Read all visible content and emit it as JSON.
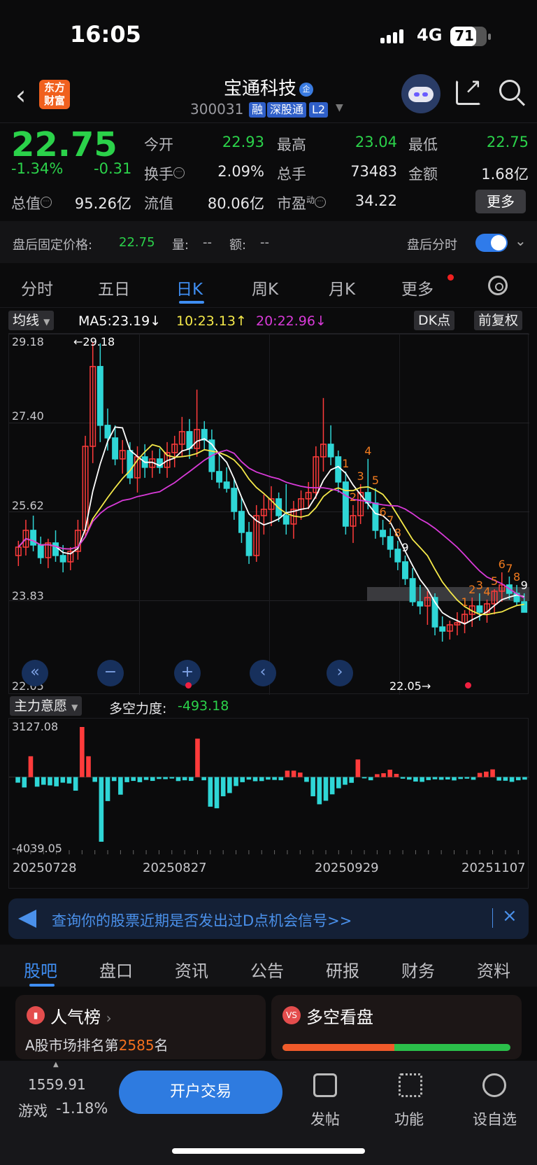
{
  "status_bar": {
    "time": "16:05",
    "network": "4G",
    "battery": "71"
  },
  "header": {
    "logo": "东方财富",
    "stock_name": "宝通科技",
    "name_badge": "企",
    "stock_code": "300031",
    "tags": [
      "融",
      "深股通",
      "L2"
    ]
  },
  "quote": {
    "price": "22.75",
    "change_pct": "-1.34%",
    "change": "-0.31",
    "rows": [
      {
        "l1": "今开",
        "v1": "22.93",
        "l2": "最高",
        "v2": "23.04",
        "l3": "最低",
        "v3": "22.75"
      },
      {
        "l1": "换手",
        "v1": "2.09%",
        "l2": "总手",
        "v2": "73483",
        "l3": "金额",
        "v3": "1.68亿"
      },
      {
        "l0": "总值",
        "v0": "95.26亿",
        "l1": "流值",
        "v1": "80.06亿",
        "l2": "市盈",
        "l2sup": "动",
        "v2": "34.22"
      }
    ],
    "more_button": "更多"
  },
  "after_hours": {
    "label": "盘后固定价格:",
    "price": "22.75",
    "vol_label": "量:",
    "vol": "--",
    "amt_label": "额:",
    "amt": "--",
    "toggle_label": "盘后分时",
    "toggle_on": true
  },
  "period_tabs": [
    "分时",
    "五日",
    "日K",
    "周K",
    "月K",
    "更多"
  ],
  "active_period": "日K",
  "kline_bar": {
    "indicator": "均线",
    "ma5": "MA5:23.19",
    "ma10": "10:23.13",
    "ma20": "20:22.96",
    "dk_button": "DK点",
    "adjust_button": "前复权"
  },
  "colors": {
    "up": "#ff3b3b",
    "down": "#2fd6d6",
    "ma5": "#ffffff",
    "ma10": "#f5e94a",
    "ma20": "#d83ad8",
    "accent": "#3f8ef2",
    "green_text": "#2bd24a"
  },
  "chart_data": [
    {
      "type": "candlestick",
      "title": "日K",
      "y_axis_labels": [
        "29.18",
        "27.40",
        "25.62",
        "23.83",
        "22.05"
      ],
      "ylim": [
        22.05,
        29.18
      ],
      "max_label": "29.18",
      "min_label": "22.05",
      "series": [
        {
          "name": "MA5",
          "last": "23.19"
        },
        {
          "name": "10",
          "last": "23.13"
        },
        {
          "name": "20",
          "last": "22.96"
        }
      ],
      "candles": [
        [
          24.1,
          24.45,
          23.85,
          24.3
        ],
        [
          24.3,
          24.95,
          24.1,
          24.7
        ],
        [
          24.7,
          25.05,
          24.2,
          24.35
        ],
        [
          24.35,
          24.55,
          23.9,
          24.05
        ],
        [
          24.05,
          24.5,
          23.8,
          24.4
        ],
        [
          24.4,
          24.7,
          23.95,
          24.1
        ],
        [
          24.1,
          24.35,
          23.7,
          23.95
        ],
        [
          23.95,
          24.3,
          23.75,
          24.2
        ],
        [
          24.2,
          24.95,
          24.0,
          24.7
        ],
        [
          24.7,
          26.95,
          24.55,
          26.7
        ],
        [
          26.7,
          29.18,
          26.3,
          28.6
        ],
        [
          28.6,
          29.15,
          26.8,
          27.2
        ],
        [
          27.2,
          27.6,
          26.6,
          26.9
        ],
        [
          26.9,
          27.2,
          26.25,
          26.4
        ],
        [
          26.4,
          26.85,
          26.05,
          26.6
        ],
        [
          26.6,
          26.8,
          25.8,
          25.95
        ],
        [
          25.95,
          26.7,
          25.6,
          26.45
        ],
        [
          26.45,
          26.75,
          25.95,
          26.2
        ],
        [
          26.2,
          26.6,
          25.95,
          26.4
        ],
        [
          26.4,
          26.65,
          26.05,
          26.2
        ],
        [
          26.2,
          26.8,
          25.95,
          26.55
        ],
        [
          26.55,
          26.95,
          26.2,
          26.75
        ],
        [
          26.75,
          27.4,
          26.45,
          27.05
        ],
        [
          27.05,
          27.35,
          26.4,
          26.65
        ],
        [
          26.65,
          28.05,
          26.45,
          27.1
        ],
        [
          27.1,
          27.3,
          26.6,
          26.85
        ],
        [
          26.85,
          27.1,
          25.9,
          26.1
        ],
        [
          26.1,
          26.5,
          25.7,
          25.85
        ],
        [
          25.85,
          26.2,
          25.6,
          25.7
        ],
        [
          25.7,
          25.95,
          24.95,
          25.15
        ],
        [
          25.15,
          25.5,
          24.4,
          24.65
        ],
        [
          24.65,
          24.9,
          23.9,
          24.1
        ],
        [
          24.1,
          25.3,
          23.95,
          25.05
        ],
        [
          25.05,
          25.55,
          24.6,
          25.2
        ],
        [
          25.2,
          25.75,
          24.8,
          25.45
        ],
        [
          25.45,
          25.6,
          24.9,
          25.05
        ],
        [
          25.05,
          25.8,
          24.6,
          24.85
        ],
        [
          24.85,
          25.4,
          24.5,
          25.2
        ],
        [
          25.2,
          25.65,
          24.95,
          25.45
        ],
        [
          25.45,
          25.85,
          25.2,
          25.6
        ],
        [
          25.6,
          26.7,
          25.45,
          26.45
        ],
        [
          26.45,
          27.85,
          26.1,
          26.75
        ],
        [
          26.75,
          27.2,
          26.25,
          26.45
        ],
        [
          26.45,
          26.6,
          25.6,
          25.85
        ],
        [
          25.85,
          26.1,
          24.6,
          24.8
        ],
        [
          24.8,
          25.3,
          24.4,
          25.05
        ],
        [
          25.05,
          25.8,
          24.85,
          25.6
        ],
        [
          25.6,
          26.4,
          25.2,
          25.35
        ],
        [
          25.35,
          25.7,
          24.5,
          24.7
        ],
        [
          24.7,
          24.95,
          24.35,
          24.55
        ],
        [
          24.55,
          24.75,
          24.05,
          24.25
        ],
        [
          24.25,
          24.45,
          23.75,
          23.95
        ],
        [
          23.95,
          24.1,
          23.4,
          23.55
        ],
        [
          23.55,
          23.8,
          22.9,
          23.0
        ],
        [
          23.0,
          23.4,
          22.7,
          22.9
        ],
        [
          22.9,
          23.25,
          22.45,
          23.1
        ],
        [
          23.1,
          23.2,
          22.2,
          22.4
        ],
        [
          22.4,
          22.65,
          22.05,
          22.3
        ],
        [
          22.3,
          22.55,
          22.1,
          22.45
        ],
        [
          22.45,
          22.75,
          22.2,
          22.5
        ],
        [
          22.5,
          22.8,
          22.25,
          22.7
        ],
        [
          22.7,
          23.1,
          22.4,
          22.9
        ],
        [
          22.9,
          23.2,
          22.55,
          22.75
        ],
        [
          22.75,
          23.05,
          22.5,
          22.95
        ],
        [
          22.95,
          23.3,
          22.7,
          23.25
        ],
        [
          23.25,
          23.7,
          23.0,
          23.4
        ],
        [
          23.4,
          23.6,
          23.05,
          23.2
        ],
        [
          23.2,
          23.4,
          22.9,
          23.0
        ],
        [
          23.0,
          23.2,
          22.75,
          22.75
        ]
      ],
      "td_counts": [
        "1",
        "2",
        "3",
        "4",
        "5",
        "6",
        "7",
        "8",
        "9",
        "1",
        "2",
        "3",
        "4",
        "5",
        "6",
        "7",
        "8",
        "9"
      ]
    },
    {
      "type": "bar",
      "title": "主力意愿",
      "indicator_label": "多空力度:",
      "indicator_value": "-493.18",
      "ylim": [
        -4039.05,
        3127.08
      ],
      "y_axis_labels": [
        "3127.08",
        "-4039.05"
      ],
      "x_labels": [
        "20250728",
        "20250827",
        "20250929",
        "20251107"
      ],
      "values": [
        -350,
        -650,
        1300,
        -600,
        -480,
        -520,
        -580,
        -350,
        -400,
        -850,
        3127,
        1300,
        -300,
        -4039,
        -1500,
        -250,
        -1100,
        -320,
        -240,
        -320,
        -180,
        -240,
        -120,
        -130,
        -90,
        -250,
        -200,
        -240,
        2400,
        -200,
        -1850,
        -1950,
        -1200,
        -1000,
        -560,
        -320,
        -160,
        -260,
        -250,
        -160,
        -180,
        -200,
        400,
        400,
        280,
        -300,
        -1200,
        -1700,
        -1480,
        -1080,
        -700,
        -480,
        -360,
        1100,
        -80,
        -200,
        180,
        240,
        460,
        200,
        -100,
        -160,
        -280,
        -300,
        -190,
        -140,
        -170,
        -150,
        -210,
        -120,
        -100,
        -170,
        260,
        340,
        480,
        -220,
        -230,
        -300,
        -200,
        -160
      ]
    }
  ],
  "controls": [
    "«",
    "−",
    "+",
    "‹",
    "›"
  ],
  "lower_indicator": {
    "name": "主力意愿",
    "label": "多空力度:",
    "value": "-493.18"
  },
  "banner": {
    "text": "查询你的股票近期是否发出过D点机会信号>>",
    "close": "×"
  },
  "bottom_tabs": [
    "股吧",
    "盘口",
    "资讯",
    "公告",
    "研报",
    "财务",
    "资料"
  ],
  "active_bottom_tab": "股吧",
  "cards": {
    "rank": {
      "title": "人气榜",
      "text_prefix": "A股市场排名第",
      "rank": "2585",
      "text_suffix": "名"
    },
    "bullbear": {
      "badge": "VS",
      "title": "多空看盘",
      "bull_ratio": 0.49
    }
  },
  "footer": {
    "index_value": "1559.91",
    "index_name": "游戏",
    "index_change": "-1.18%",
    "open_button": "开户交易",
    "post": "发帖",
    "functions": "功能",
    "watchlist": "设自选"
  }
}
